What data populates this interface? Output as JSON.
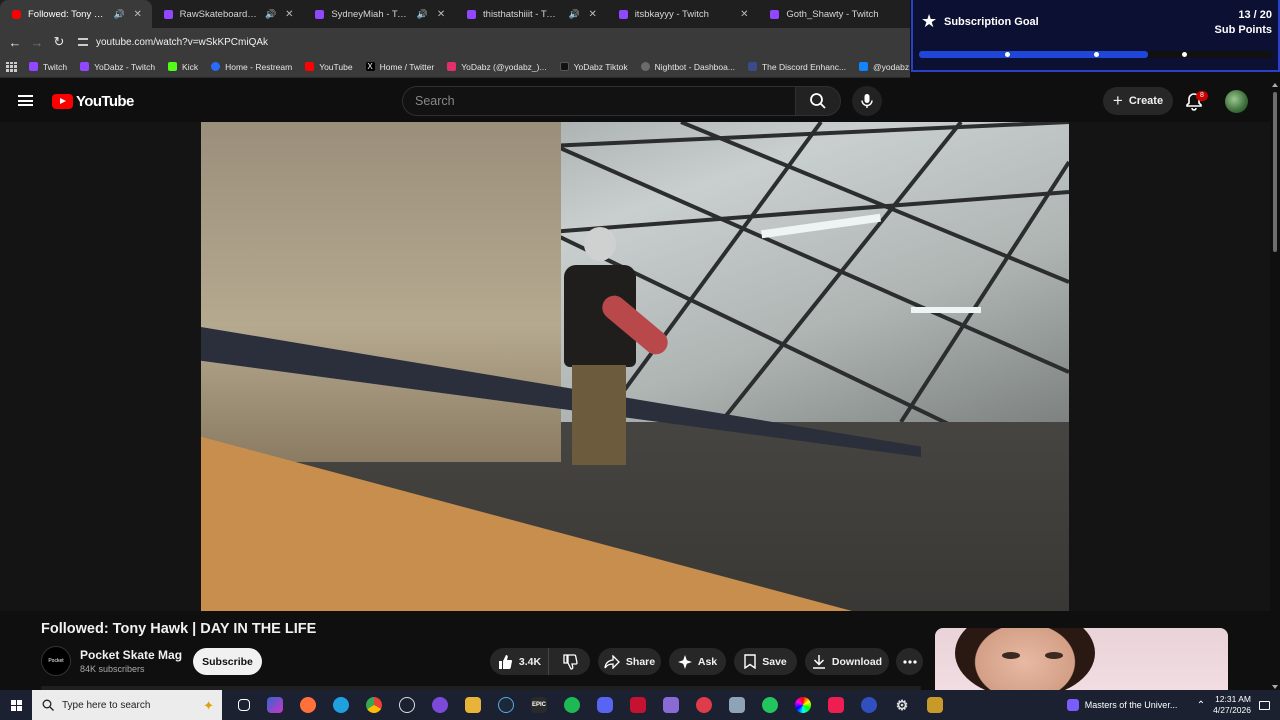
{
  "browser": {
    "tabs": [
      {
        "title": "Followed: Tony Hawk | DAY",
        "favicon": "youtube-icon",
        "sound": true,
        "active": true
      },
      {
        "title": "RawSkateboards - Twitch",
        "favicon": "twitch-icon",
        "sound": true,
        "active": false
      },
      {
        "title": "SydneyMiah - Twitch",
        "favicon": "twitch-icon",
        "sound": true,
        "active": false
      },
      {
        "title": "thisthatshiiit - Twitch",
        "favicon": "twitch-icon",
        "sound": true,
        "active": false
      },
      {
        "title": "itsbkayyy - Twitch",
        "favicon": "twitch-icon",
        "sound": false,
        "active": false
      },
      {
        "title": "Goth_Shawty - Twitch",
        "favicon": "twitch-icon",
        "sound": false,
        "active": false
      }
    ],
    "url": "youtube.com/watch?v=wSkKPCmiQAk",
    "bookmarks": [
      {
        "label": "Twitch",
        "color": "#9146ff"
      },
      {
        "label": "YoDabz - Twitch",
        "color": "#9146ff"
      },
      {
        "label": "Kick",
        "color": "#53fc18"
      },
      {
        "label": "Home - Restream",
        "color": "#2a6bff"
      },
      {
        "label": "YouTube",
        "color": "#ff0000"
      },
      {
        "label": "Home / Twitter",
        "color": "#000000"
      },
      {
        "label": "YoDabz (@yodabz_)...",
        "color": "#e1306c"
      },
      {
        "label": "YoDabz Tiktok",
        "color": "#111111"
      },
      {
        "label": "Nightbot - Dashboa...",
        "color": "#6b6b6b"
      },
      {
        "label": "The Discord Enhanc...",
        "color": "#3b4a8a"
      },
      {
        "label": "@yodabz.bsky.socia...",
        "color": "#1185fe"
      }
    ]
  },
  "goal": {
    "title": "Subscription Goal",
    "count": "13 / 20",
    "unit": "Sub Points",
    "progress": 0.65,
    "ticks": [
      0.25,
      0.5,
      0.75
    ]
  },
  "youtube": {
    "logo": "YouTube",
    "search_placeholder": "Search",
    "create_label": "Create",
    "notifications": "8"
  },
  "video": {
    "title": "Followed: Tony Hawk | DAY IN THE LIFE",
    "channel": "Pocket Skate Mag",
    "subscribers": "84K subscribers",
    "channel_avatar_text": "Pocket",
    "subscribe_label": "Subscribe",
    "likes": "3.4K",
    "share_label": "Share",
    "ask_label": "Ask",
    "save_label": "Save",
    "download_label": "Download"
  },
  "taskbar": {
    "search_placeholder": "Type here to search",
    "media_title": "Masters of the Univer...",
    "time": "12:31 AM",
    "date": "4/27/2026"
  }
}
